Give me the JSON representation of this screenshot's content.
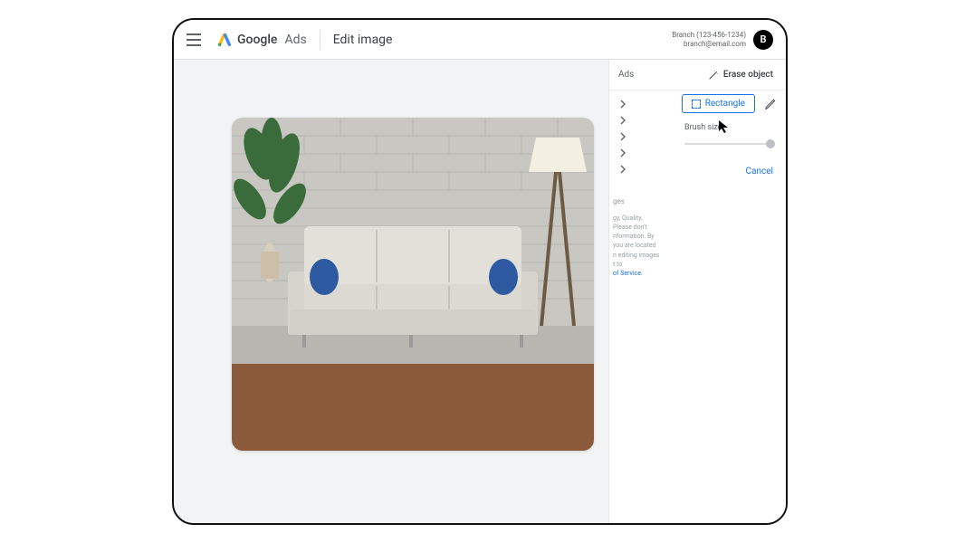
{
  "header": {
    "brand_google": "Google",
    "brand_ads": "Ads",
    "page_title": "Edit image",
    "account_line1": "Branch (123-456-1234)",
    "account_line2": "branch@email.com",
    "avatar_letter": "B"
  },
  "tabs": {
    "left_truncated": "Ads",
    "right": "Erase object"
  },
  "tools": {
    "rectangle_label": "Rectangle",
    "brush_label": "Brush size"
  },
  "actions": {
    "cancel": "Cancel"
  },
  "fragments": {
    "ges": "ges",
    "line1": "gy, Quality,",
    "line2": "Please don't",
    "line3": "nformation. By",
    "line4": "you are located",
    "line5": "n editing images",
    "line6": "t to",
    "line7": "of Service."
  }
}
